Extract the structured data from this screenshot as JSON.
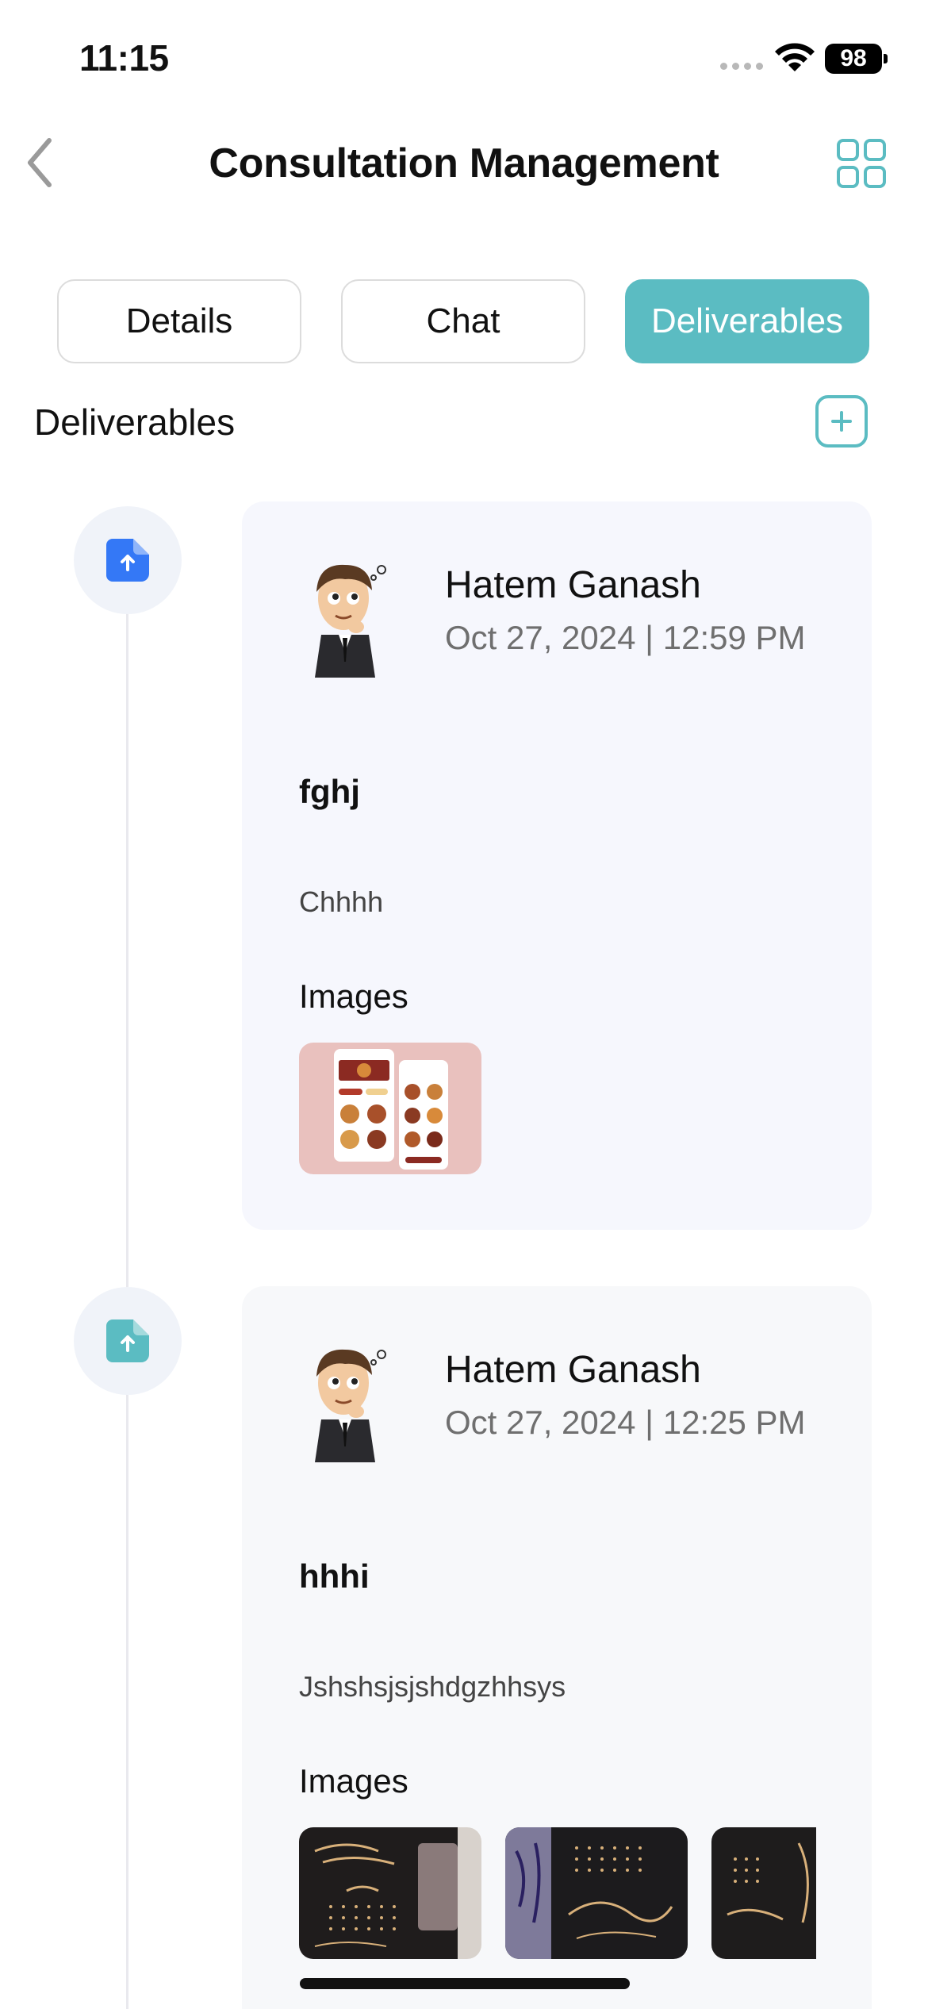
{
  "status_bar": {
    "time": "11:15",
    "battery": "98"
  },
  "nav": {
    "title": "Consultation Management"
  },
  "tabs": [
    {
      "label": "Details",
      "active": false
    },
    {
      "label": "Chat",
      "active": false
    },
    {
      "label": "Deliverables",
      "active": true
    }
  ],
  "section": {
    "title": "Deliverables"
  },
  "colors": {
    "accent": "#5bbcc2",
    "upload_blue": "#3478f6"
  },
  "deliverables": [
    {
      "icon": "file-upload-icon-blue",
      "author": "Hatem Ganash",
      "date": "Oct 27, 2024 | 12:59 PM",
      "title": "fghj",
      "description": "Chhhh",
      "images_label": "Images"
    },
    {
      "icon": "file-upload-icon-teal",
      "author": "Hatem Ganash",
      "date": "Oct 27, 2024 | 12:25 PM",
      "title": "hhhi",
      "description": "Jshshsjsjshdgzhhsys",
      "images_label": "Images"
    }
  ]
}
